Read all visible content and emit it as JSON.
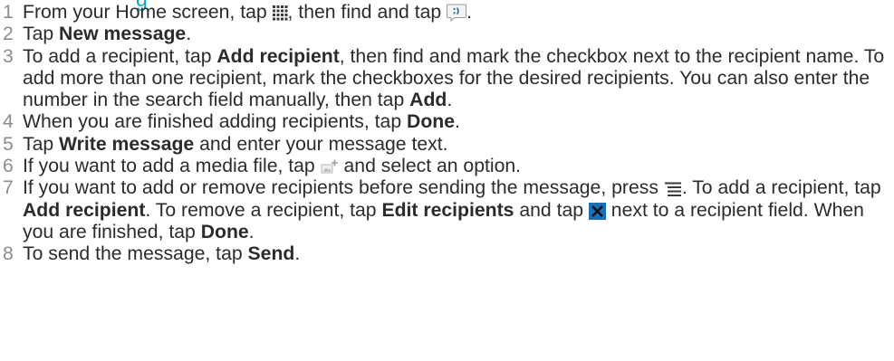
{
  "heading": "g",
  "steps": [
    {
      "n": "1",
      "a": "From your Home screen, tap ",
      "b": ", then find and tap ",
      "c": "."
    },
    {
      "n": "2",
      "a": "Tap ",
      "b": "New message",
      "c": "."
    },
    {
      "n": "3",
      "a": "To add a recipient, tap ",
      "b": "Add recipient",
      "c": ", then find and mark the checkbox next to the recipient name. To add more than one recipient, mark the checkboxes for the desired recipients. You can also enter the number in the search field manually, then tap ",
      "d": "Add",
      "e": "."
    },
    {
      "n": "4",
      "a": "When you are finished adding recipients, tap ",
      "b": "Done",
      "c": "."
    },
    {
      "n": "5",
      "a": "Tap ",
      "b": "Write message",
      "c": " and enter your message text."
    },
    {
      "n": "6",
      "a": "If you want to add a media file, tap ",
      "b": " and select an option."
    },
    {
      "n": "7",
      "a": "If you want to add or remove recipients before sending the message, press ",
      "b": ". To add a recipient, tap ",
      "c": "Add recipient",
      "d": ". To remove a recipient, tap ",
      "e": "Edit recipients",
      "f": " and tap ",
      "g": " next to a recipient field. When you are finished, tap ",
      "h": "Done",
      "i": "."
    },
    {
      "n": "8",
      "a": "To send the message, tap ",
      "b": "Send",
      "c": "."
    }
  ],
  "icons": {
    "apps": "app-grid-icon",
    "messaging": "messaging-icon",
    "attach": "attach-media-icon",
    "menu": "menu-icon",
    "remove": "remove-x-icon"
  },
  "colors": {
    "heading": "#00a9d4",
    "text": "#2b2b2b",
    "number": "#8c8c8c",
    "icon_blue": "#1b6fb5"
  }
}
